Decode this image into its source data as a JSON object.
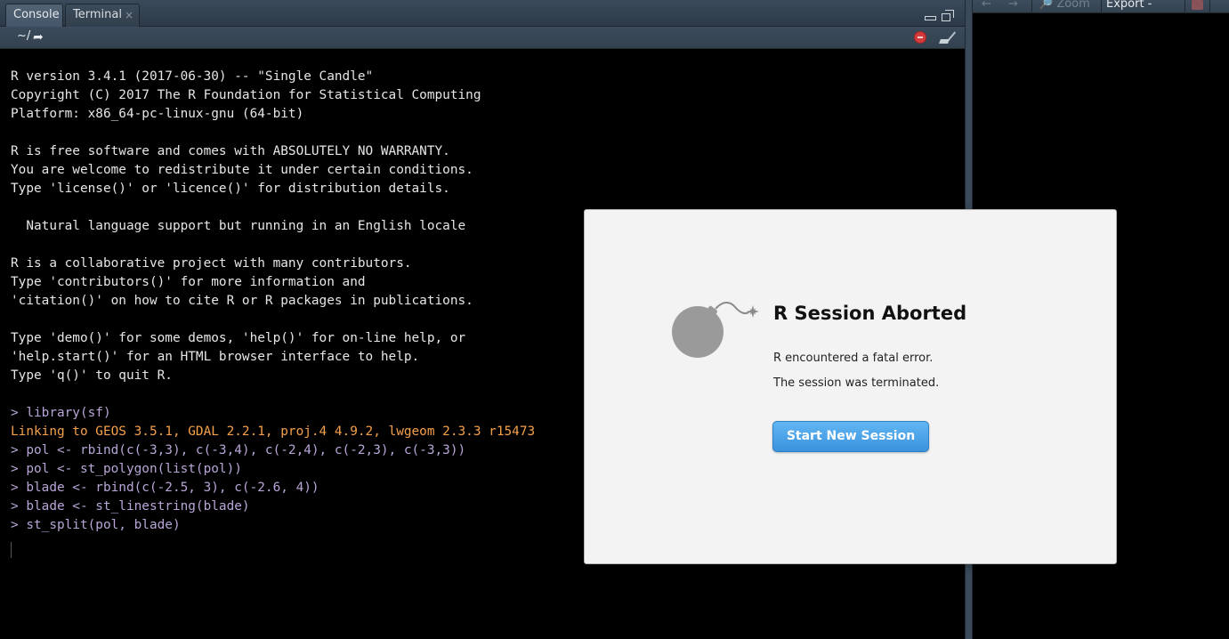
{
  "console": {
    "tabs": [
      {
        "label": "Console"
      },
      {
        "label": "Terminal",
        "close": "×"
      }
    ],
    "working_dir": "~/",
    "output": [
      {
        "text": "R version 3.4.1 (2017-06-30) -- \"Single Candle\"",
        "kind": "normal"
      },
      {
        "text": "Copyright (C) 2017 The R Foundation for Statistical Computing",
        "kind": "normal"
      },
      {
        "text": "Platform: x86_64-pc-linux-gnu (64-bit)",
        "kind": "normal"
      },
      {
        "text": "",
        "kind": "normal"
      },
      {
        "text": "R is free software and comes with ABSOLUTELY NO WARRANTY.",
        "kind": "normal"
      },
      {
        "text": "You are welcome to redistribute it under certain conditions.",
        "kind": "normal"
      },
      {
        "text": "Type 'license()' or 'licence()' for distribution details.",
        "kind": "normal"
      },
      {
        "text": "",
        "kind": "normal"
      },
      {
        "text": "  Natural language support but running in an English locale",
        "kind": "normal"
      },
      {
        "text": "",
        "kind": "normal"
      },
      {
        "text": "R is a collaborative project with many contributors.",
        "kind": "normal"
      },
      {
        "text": "Type 'contributors()' for more information and",
        "kind": "normal"
      },
      {
        "text": "'citation()' on how to cite R or R packages in publications.",
        "kind": "normal"
      },
      {
        "text": "",
        "kind": "normal"
      },
      {
        "text": "Type 'demo()' for some demos, 'help()' for on-line help, or",
        "kind": "normal"
      },
      {
        "text": "'help.start()' for an HTML browser interface to help.",
        "kind": "normal"
      },
      {
        "text": "Type 'q()' to quit R.",
        "kind": "normal"
      },
      {
        "text": "",
        "kind": "normal"
      },
      {
        "text": "> library(sf)",
        "kind": "cmd"
      },
      {
        "text": "Linking to GEOS 3.5.1, GDAL 2.2.1, proj.4 4.9.2, lwgeom 2.3.3 r15473",
        "kind": "warn"
      },
      {
        "text": "> pol <- rbind(c(-3,3), c(-3,4), c(-2,4), c(-2,3), c(-3,3))",
        "kind": "cmd"
      },
      {
        "text": "> pol <- st_polygon(list(pol))",
        "kind": "cmd"
      },
      {
        "text": "> blade <- rbind(c(-2.5, 3), c(-2.6, 4))",
        "kind": "cmd"
      },
      {
        "text": "> blade <- st_linestring(blade)",
        "kind": "cmd"
      },
      {
        "text": "> st_split(pol, blade)",
        "kind": "cmd"
      }
    ]
  },
  "plots_toolbar": {
    "back_icon": "←",
    "forward_icon": "→",
    "zoom_label": "🔎 Zoom",
    "export_label": "Export -"
  },
  "modal": {
    "title": "R Session Aborted",
    "message_1": "R encountered a fatal error.",
    "message_2": "The session was terminated.",
    "button_label": "Start New Session"
  },
  "colors": {
    "console_text": "#e6e6e6",
    "command_text": "#b9a6d8",
    "warning_text": "#f5a04b",
    "button_blue": "#3a92de"
  }
}
